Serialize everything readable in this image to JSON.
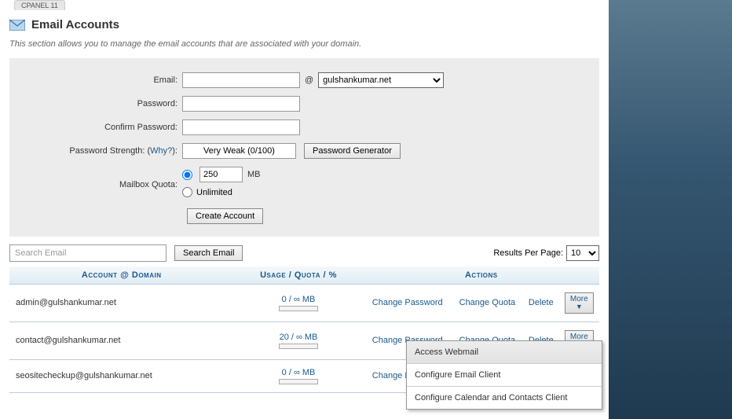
{
  "top_tab": "CPANEL 11",
  "header": {
    "title": "Email Accounts"
  },
  "intro": "This section allows you to manage the email accounts that are associated with your domain.",
  "form": {
    "email_label": "Email:",
    "email_value": "",
    "at": "@",
    "domain_selected": "gulshankumar.net",
    "password_label": "Password:",
    "password_value": "",
    "confirm_label": "Confirm Password:",
    "confirm_value": "",
    "strength_label_pre": "Password Strength: (",
    "strength_why": "Why?",
    "strength_label_post": "):",
    "strength_value": "Very Weak (0/100)",
    "generator_btn": "Password Generator",
    "quota_label": "Mailbox Quota:",
    "quota_value": "250",
    "quota_unit": "MB",
    "unlimited_label": "Unlimited",
    "create_btn": "Create Account"
  },
  "search": {
    "placeholder": "Search Email",
    "button": "Search Email",
    "rpp_label": "Results Per Page:",
    "rpp_value": "10"
  },
  "table": {
    "col_account": "Account @ Domain",
    "col_usage": "Usage / Quota / %",
    "col_actions": "Actions",
    "change_pw": "Change Password",
    "change_quota": "Change Quota",
    "delete": "Delete",
    "more": "More",
    "rows": [
      {
        "account": "admin@gulshankumar.net",
        "usage": "0 / ∞ MB"
      },
      {
        "account": "contact@gulshankumar.net",
        "usage": "20 / ∞ MB"
      },
      {
        "account": "seositecheckup@gulshankumar.net",
        "usage": "0 / ∞ MB"
      }
    ]
  },
  "dropdown": {
    "item1": "Access Webmail",
    "item2": "Configure Email Client",
    "item3": "Configure Calendar and Contacts Client"
  }
}
